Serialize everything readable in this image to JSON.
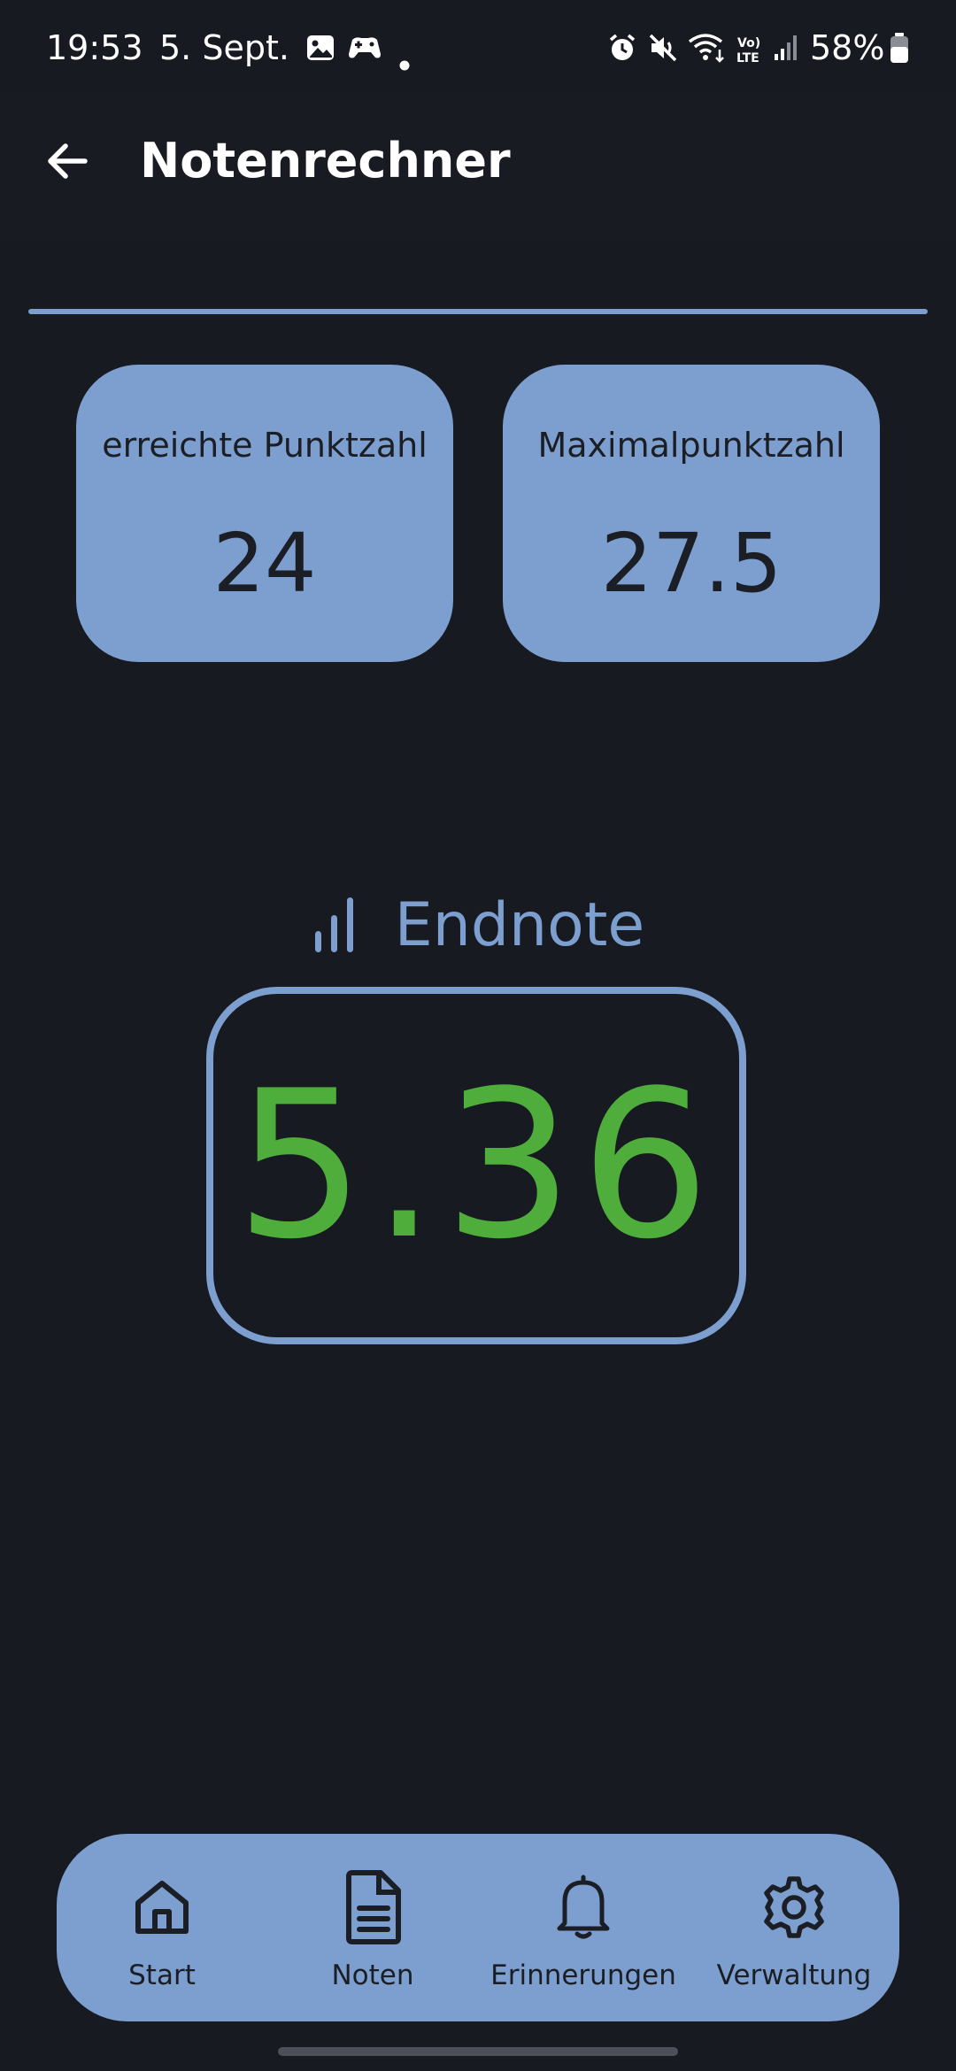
{
  "status_bar": {
    "time": "19:53",
    "date": "5. Sept.",
    "battery": "58%",
    "left_icons": [
      "gallery-icon",
      "game-controller-icon",
      "dot-icon"
    ],
    "right_icons": [
      "alarm-icon",
      "mute-icon",
      "wifi-icon",
      "volte-icon",
      "signal-icon",
      "battery-icon"
    ]
  },
  "app_bar": {
    "title": "Notenrechner",
    "back_icon": "arrow-left-icon"
  },
  "cards": [
    {
      "label": "erreichte Punktzahl",
      "value": "24"
    },
    {
      "label": "Maximalpunktzahl",
      "value": "27.5"
    }
  ],
  "result": {
    "heading": "Endnote",
    "icon": "bar-chart-icon",
    "value": "5.36",
    "value_color": "#4fae3b"
  },
  "bottom_nav": {
    "items": [
      {
        "label": "Start",
        "icon": "home-icon"
      },
      {
        "label": "Noten",
        "icon": "document-icon"
      },
      {
        "label": "Erinnerungen",
        "icon": "bell-icon"
      },
      {
        "label": "Verwaltung",
        "icon": "gear-icon"
      }
    ]
  },
  "colors": {
    "background": "#171a20",
    "accent": "#7d9fcf",
    "grade_good": "#4fae3b",
    "dark_text": "#1b1e25"
  }
}
